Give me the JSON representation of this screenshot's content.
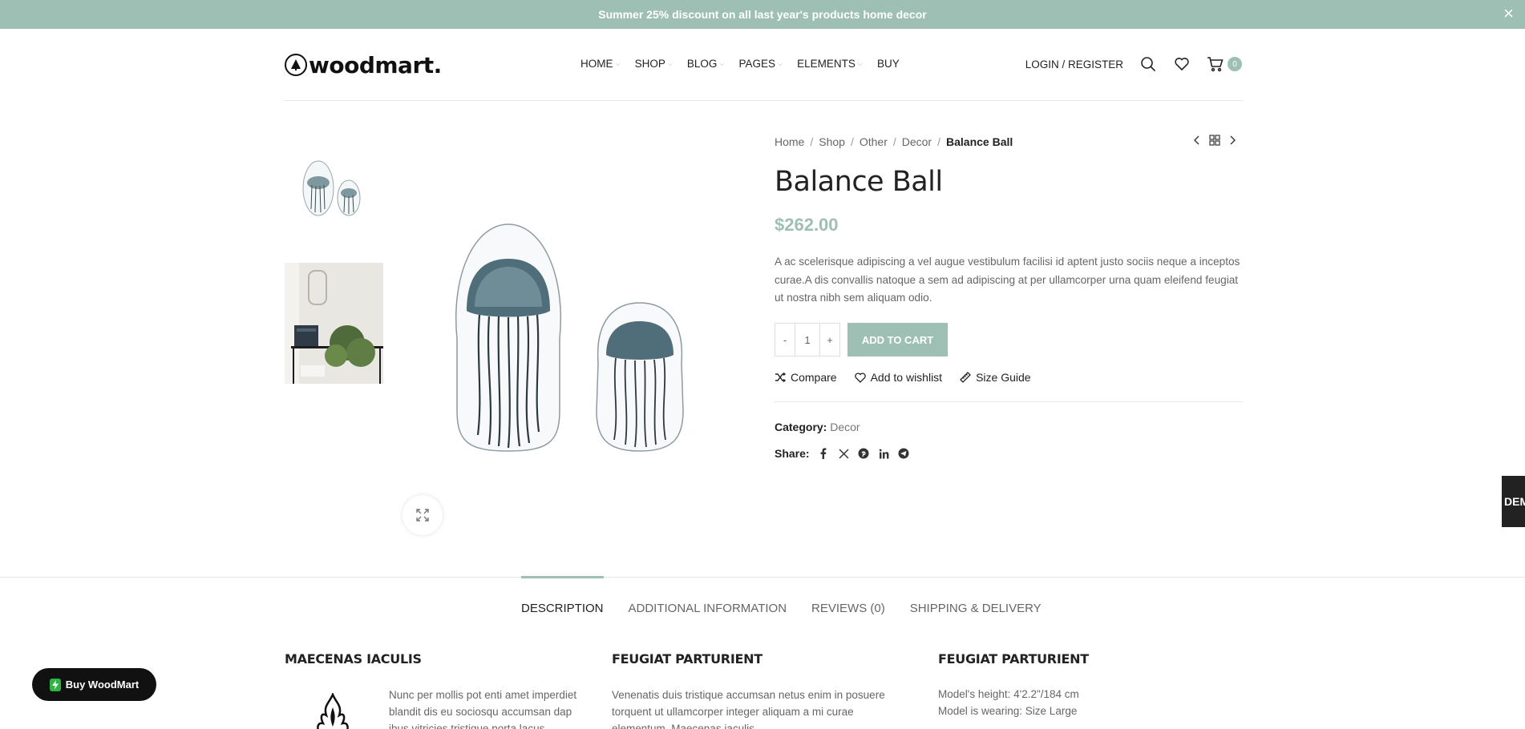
{
  "promo": {
    "text": "Summer 25% discount on all last year's products home decor",
    "close": "×"
  },
  "header": {
    "logo_text": "woodmart.",
    "nav": [
      {
        "label": "HOME",
        "has_caret": true
      },
      {
        "label": "SHOP",
        "has_caret": true
      },
      {
        "label": "BLOG",
        "has_caret": true
      },
      {
        "label": "PAGES",
        "has_caret": true
      },
      {
        "label": "ELEMENTS",
        "has_caret": true
      },
      {
        "label": "BUY",
        "has_caret": false
      }
    ],
    "login": "LOGIN / REGISTER",
    "cart_count": "0",
    "icons": [
      "search-icon",
      "heart-icon",
      "cart-icon"
    ]
  },
  "breadcrumb": [
    "Home",
    "Shop",
    "Other",
    "Decor"
  ],
  "breadcrumb_current": "Balance Ball",
  "breadcrumb_sep": "/",
  "product": {
    "title": "Balance Ball",
    "price": "$262.00",
    "description": "A ac scelerisque adipiscing a vel augue vestibulum facilisi id aptent justo sociis neque a inceptos curae.A dis convallis natoque a sem ad adipiscing at per ullamcorper urna quam eleifend feugiat ut nostra nibh sem aliquam odio.",
    "qty_minus": "-",
    "qty_value": "1",
    "qty_plus": "+",
    "add_to_cart": "ADD TO CART",
    "compare": "Compare",
    "wishlist": "Add to wishlist",
    "size_guide": "Size Guide",
    "category_label": "Category:",
    "category_value": "Decor",
    "share_label": "Share:"
  },
  "demos": "DEMOS",
  "tabs": [
    "DESCRIPTION",
    "ADDITIONAL INFORMATION",
    "REVIEWS (0)",
    "SHIPPING & DELIVERY"
  ],
  "columns": [
    {
      "heading": "MAECENAS IACULIS",
      "text": "Nunc per mollis pot enti amet imperdiet blandit dis eu sociosqu accumsan dap ibus vitricies tristique porta lacus."
    },
    {
      "heading": "FEUGIAT PARTURIENT",
      "text": "Venenatis duis tristique accumsan netus enim in posuere torquent ut ullamcorper integer aliquam a mi curae elementum. Maecenas iaculis"
    },
    {
      "heading": "FEUGIAT PARTURIENT",
      "line1": "Model's height: 4'2.2\"/184 cm",
      "line2": "Model is wearing: Size Large"
    }
  ],
  "buy_button": "Buy WoodMart",
  "colors": {
    "accent": "#9ebfb4",
    "dark": "#222222"
  }
}
